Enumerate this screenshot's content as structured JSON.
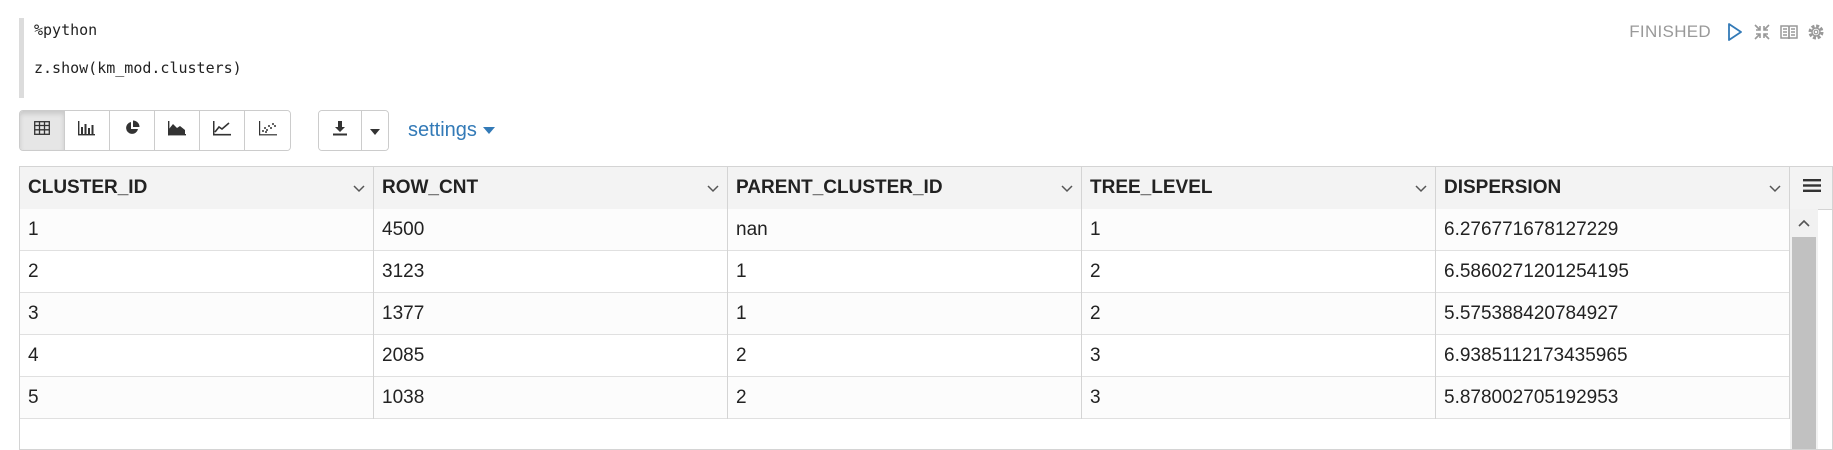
{
  "paragraph": {
    "code_line_1": "%python",
    "code_line_2": "z.show(km_mod.clusters)",
    "status": "FINISHED"
  },
  "toolbar": {
    "settings_label": "settings",
    "viz_buttons": [
      "table-icon",
      "bar-chart-icon",
      "pie-chart-icon",
      "area-chart-icon",
      "line-chart-icon",
      "scatter-chart-icon"
    ],
    "download_icon": "download-icon"
  },
  "table": {
    "columns": [
      "CLUSTER_ID",
      "ROW_CNT",
      "PARENT_CLUSTER_ID",
      "TREE_LEVEL",
      "DISPERSION"
    ],
    "rows": [
      [
        "1",
        "4500",
        "nan",
        "1",
        "6.276771678127229"
      ],
      [
        "2",
        "3123",
        "1",
        "2",
        "6.5860271201254195"
      ],
      [
        "3",
        "1377",
        "1",
        "2",
        "5.575388420784927"
      ],
      [
        "4",
        "2085",
        "2",
        "3",
        "6.9385112173435965"
      ],
      [
        "5",
        "1038",
        "2",
        "3",
        "5.878002705192953"
      ]
    ]
  },
  "colors": {
    "accent": "#337ab7",
    "status": "#999999"
  }
}
